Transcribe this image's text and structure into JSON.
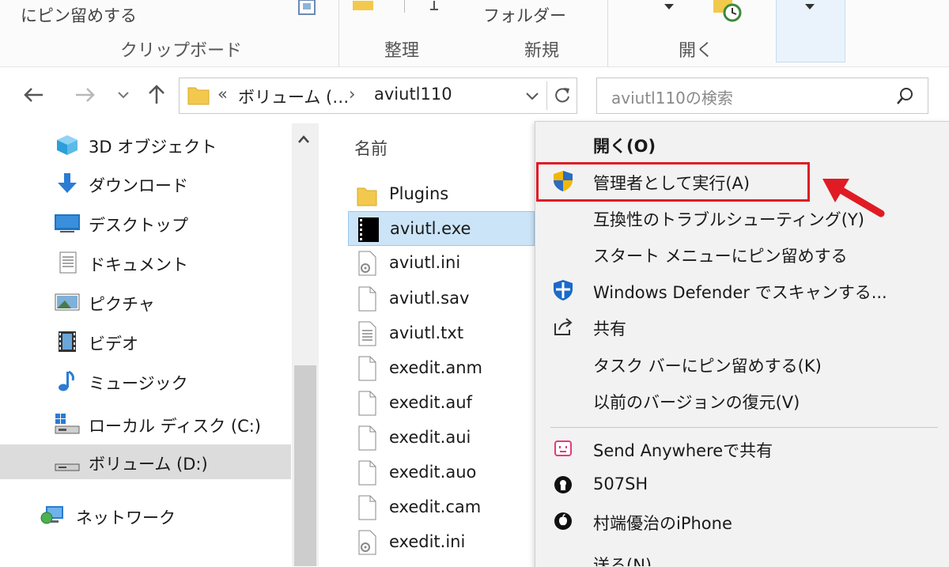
{
  "ribbon": {
    "pin_text": "にピン留めする",
    "folder_text": "フォルダー",
    "groups": {
      "clipboard": "クリップボード",
      "organize": "整理",
      "new": "新規",
      "open": "開く"
    }
  },
  "address_bar": {
    "overflow": "«",
    "crumb1": "ボリューム (…",
    "separator": "›",
    "crumb2": "aviutl110"
  },
  "search": {
    "placeholder": "aviutl110の検索"
  },
  "nav_pane": {
    "items": [
      {
        "label": "3D オブジェクト",
        "icon": "3d-objects-icon"
      },
      {
        "label": "ダウンロード",
        "icon": "download-icon"
      },
      {
        "label": "デスクトップ",
        "icon": "desktop-icon"
      },
      {
        "label": "ドキュメント",
        "icon": "documents-icon"
      },
      {
        "label": "ピクチャ",
        "icon": "pictures-icon"
      },
      {
        "label": "ビデオ",
        "icon": "video-icon"
      },
      {
        "label": "ミュージック",
        "icon": "music-icon"
      },
      {
        "label": "ローカル ディスク (C:)",
        "icon": "local-disk-icon"
      },
      {
        "label": "ボリューム (D:)",
        "icon": "drive-icon"
      },
      {
        "label": "ネットワーク",
        "icon": "network-icon"
      }
    ]
  },
  "file_list": {
    "column_name": "名前",
    "files": [
      {
        "name": "Plugins",
        "type": "folder"
      },
      {
        "name": "aviutl.exe",
        "type": "exe"
      },
      {
        "name": "aviutl.ini",
        "type": "settings"
      },
      {
        "name": "aviutl.sav",
        "type": "file"
      },
      {
        "name": "aviutl.txt",
        "type": "text"
      },
      {
        "name": "exedit.anm",
        "type": "file"
      },
      {
        "name": "exedit.auf",
        "type": "file"
      },
      {
        "name": "exedit.aui",
        "type": "file"
      },
      {
        "name": "exedit.auo",
        "type": "file"
      },
      {
        "name": "exedit.cam",
        "type": "file"
      },
      {
        "name": "exedit.ini",
        "type": "settings"
      }
    ]
  },
  "context_menu": {
    "items": [
      {
        "label": "開く(O)",
        "icon": ""
      },
      {
        "label": "管理者として実行(A)",
        "icon": "uac-shield-icon"
      },
      {
        "label": "互換性のトラブルシューティング(Y)",
        "icon": ""
      },
      {
        "label": "スタート メニューにピン留めする",
        "icon": ""
      },
      {
        "label": "Windows Defender でスキャンする...",
        "icon": "defender-icon"
      },
      {
        "label": "共有",
        "icon": "share-icon"
      },
      {
        "label": "タスク バーにピン留めする(K)",
        "icon": ""
      },
      {
        "label": "以前のバージョンの復元(V)",
        "icon": ""
      },
      {
        "label": "Send Anywhereで共有",
        "icon": "send-anywhere-icon"
      },
      {
        "label": "507SH",
        "icon": "phone-icon"
      },
      {
        "label": "村端優治のiPhone",
        "icon": "apple-icon"
      },
      {
        "label": "送る(N)",
        "icon": ""
      }
    ]
  },
  "colors": {
    "accent_selection": "#cce4f7",
    "highlight_red": "#e01b24"
  }
}
